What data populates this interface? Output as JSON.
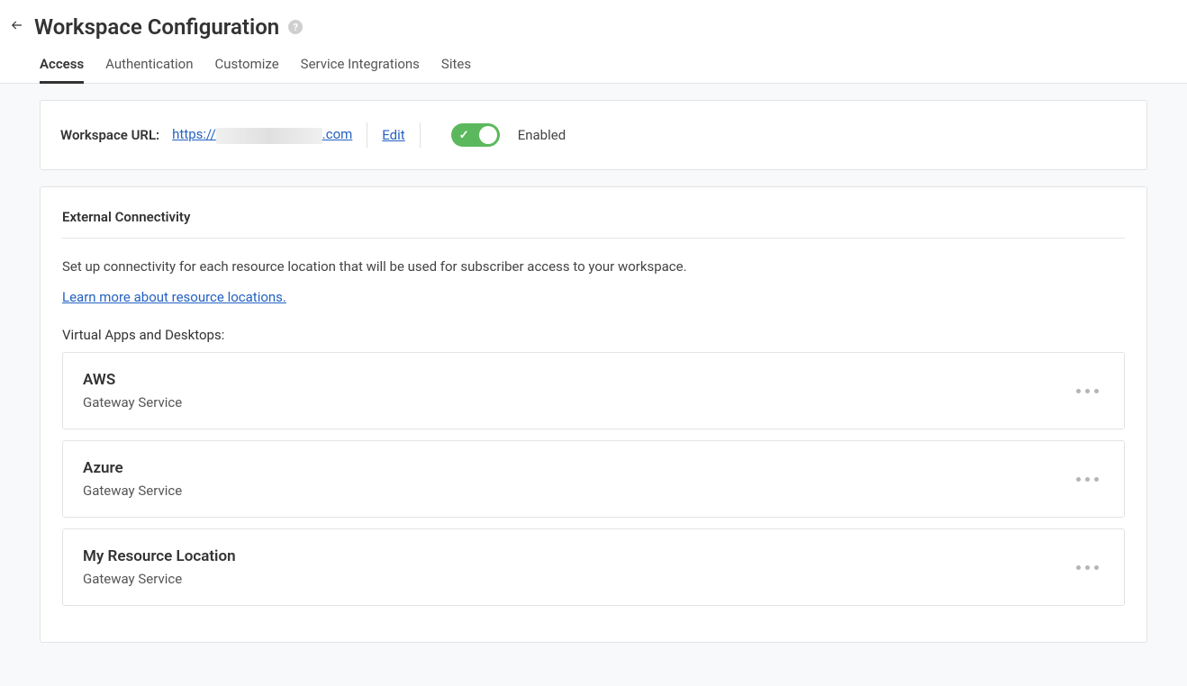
{
  "header": {
    "title": "Workspace Configuration"
  },
  "tabs": [
    {
      "label": "Access",
      "active": true
    },
    {
      "label": "Authentication",
      "active": false
    },
    {
      "label": "Customize",
      "active": false
    },
    {
      "label": "Service Integrations",
      "active": false
    },
    {
      "label": "Sites",
      "active": false
    }
  ],
  "urlCard": {
    "label": "Workspace URL:",
    "url_prefix": "https://",
    "url_suffix": ".com",
    "edit": "Edit",
    "enabledText": "Enabled"
  },
  "connectivity": {
    "title": "External Connectivity",
    "description": "Set up connectivity for each resource location that will be used for subscriber access to your workspace.",
    "learnMore": "Learn more about resource locations.",
    "subheading": "Virtual Apps and Desktops:",
    "locations": [
      {
        "name": "AWS",
        "service": "Gateway Service"
      },
      {
        "name": "Azure",
        "service": "Gateway Service"
      },
      {
        "name": "My Resource Location",
        "service": "Gateway Service"
      }
    ]
  }
}
